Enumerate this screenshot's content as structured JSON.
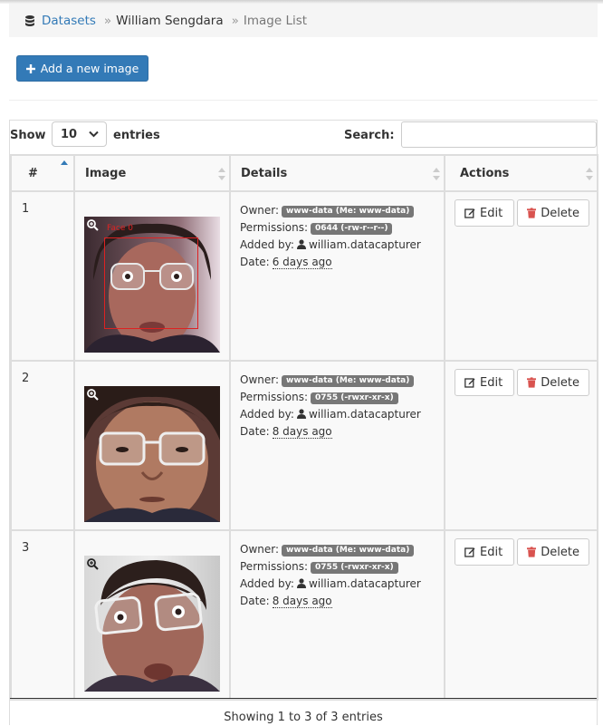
{
  "breadcrumb": {
    "icon": "database-icon",
    "root": "Datasets",
    "dataset": "William Sengdara",
    "current": "Image List",
    "separator": "»"
  },
  "toolbar": {
    "add_label": "Add a new image",
    "add_icon": "plus-icon"
  },
  "table_controls": {
    "show_label": "Show",
    "page_length": "10",
    "entries_label": "entries",
    "search_label": "Search:",
    "search_value": ""
  },
  "table": {
    "columns": [
      "#",
      "Image",
      "Details",
      "Actions"
    ],
    "labels": {
      "owner": "Owner:",
      "permissions": "Permissions:",
      "added_by": "Added by:",
      "date": "Date:"
    },
    "actions": {
      "edit": "Edit",
      "delete": "Delete"
    },
    "rows": [
      {
        "num": "1",
        "owner": "www-data (Me: www-data)",
        "permissions": "0644 (-rw-r--r--)",
        "added_by": "william.datacapturer",
        "date": "6 days ago",
        "face_label": "Face 0"
      },
      {
        "num": "2",
        "owner": "www-data (Me: www-data)",
        "permissions": "0755 (-rwxr-xr-x)",
        "added_by": "william.datacapturer",
        "date": "8 days ago"
      },
      {
        "num": "3",
        "owner": "www-data (Me: www-data)",
        "permissions": "0755 (-rwxr-xr-x)",
        "added_by": "william.datacapturer",
        "date": "8 days ago"
      }
    ]
  },
  "footer": {
    "info": "Showing 1 to 3 of 3 entries"
  },
  "colors": {
    "primary": "#337ab7",
    "danger": "#d9534f",
    "badge": "#777777",
    "face_box": "#dd2222"
  }
}
